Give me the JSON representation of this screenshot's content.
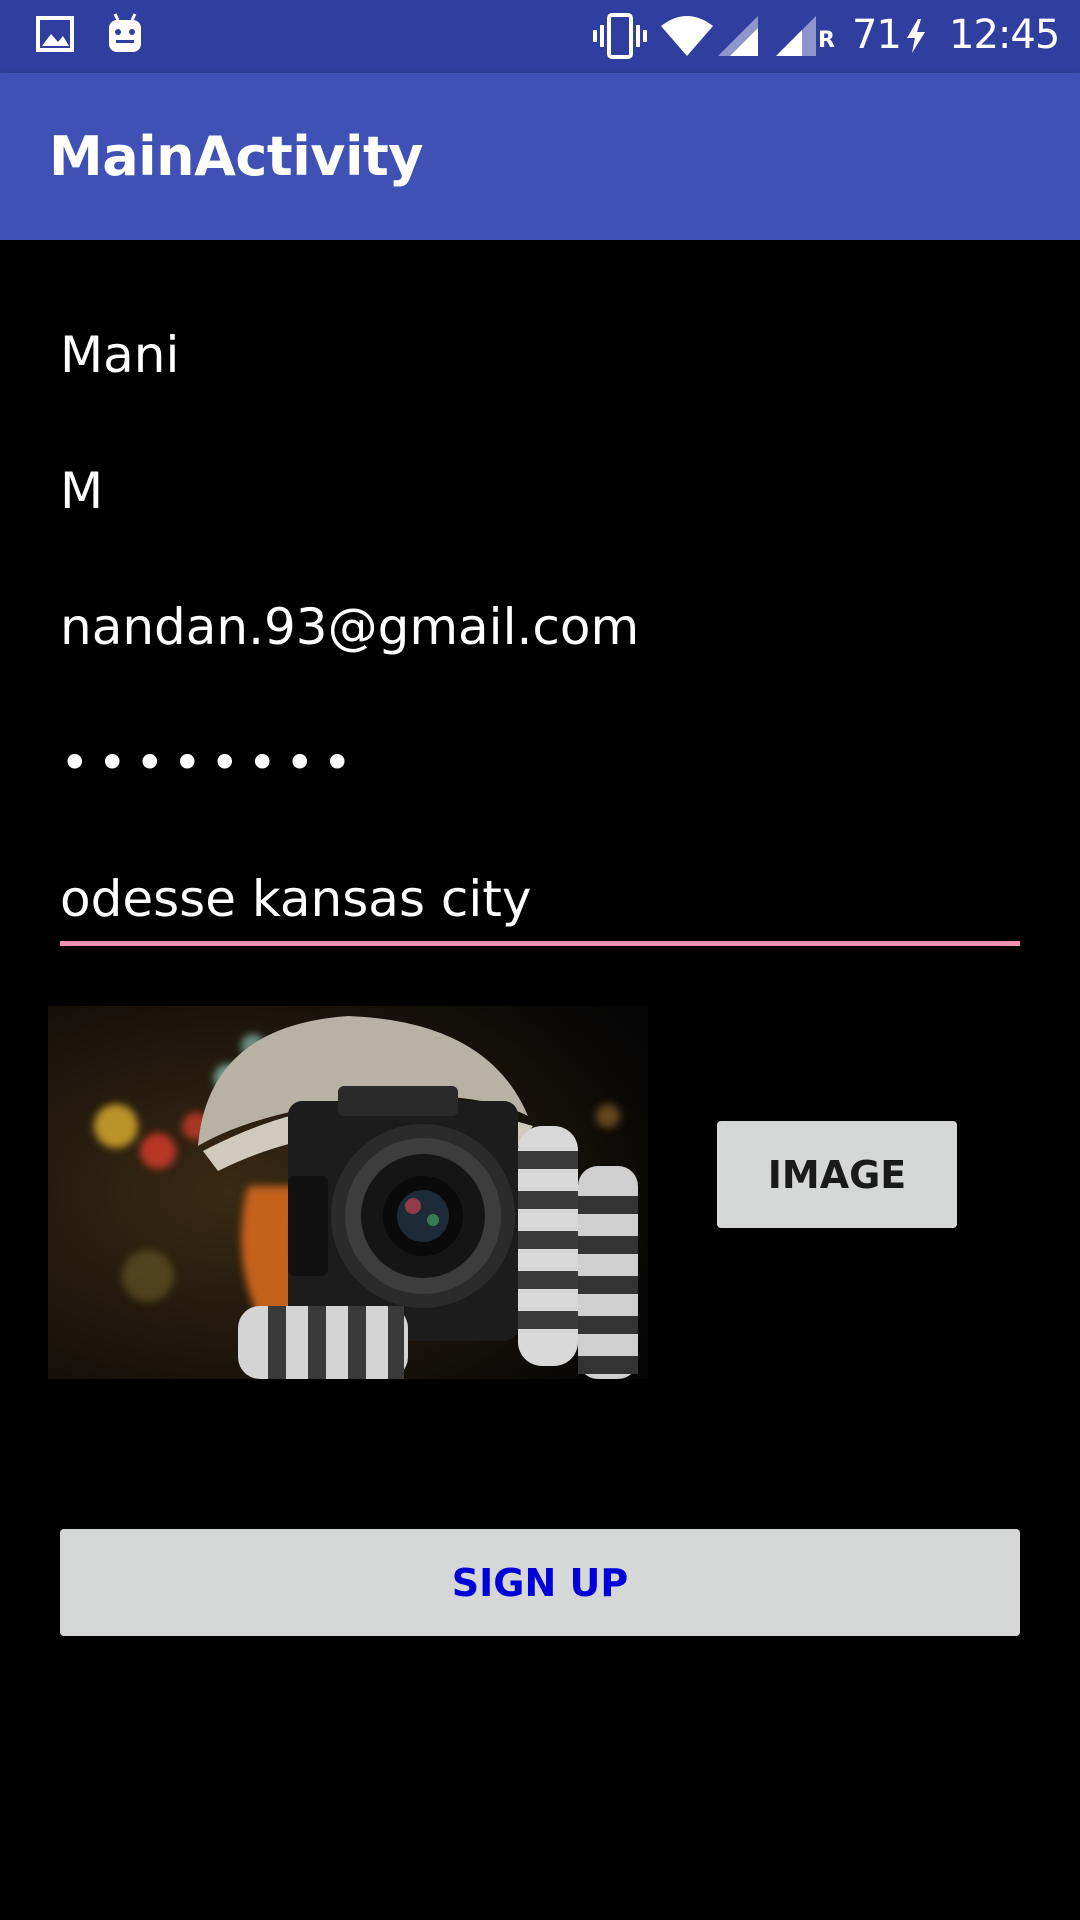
{
  "status_bar": {
    "icons": [
      "gallery-icon",
      "android-debug-icon",
      "vibrate-icon",
      "wifi-icon",
      "signal-icon",
      "signal-roaming-icon",
      "charging-icon"
    ],
    "battery_level": "71",
    "roaming_label": "R",
    "time": "12:45",
    "background_color": "#303f9f"
  },
  "app_bar": {
    "title": "MainActivity",
    "background_color": "#3f51b5"
  },
  "form": {
    "first_name_value": "Mani",
    "last_name_value": "M",
    "email_value": "nandan.93@gmail.com",
    "password_mask": "••••••••",
    "address_value": "odesse kansas city",
    "underline_color": "#f48fb1"
  },
  "image_section": {
    "button_label": "IMAGE"
  },
  "signup": {
    "button_label": "SIGN UP",
    "text_color": "#0000d8"
  }
}
